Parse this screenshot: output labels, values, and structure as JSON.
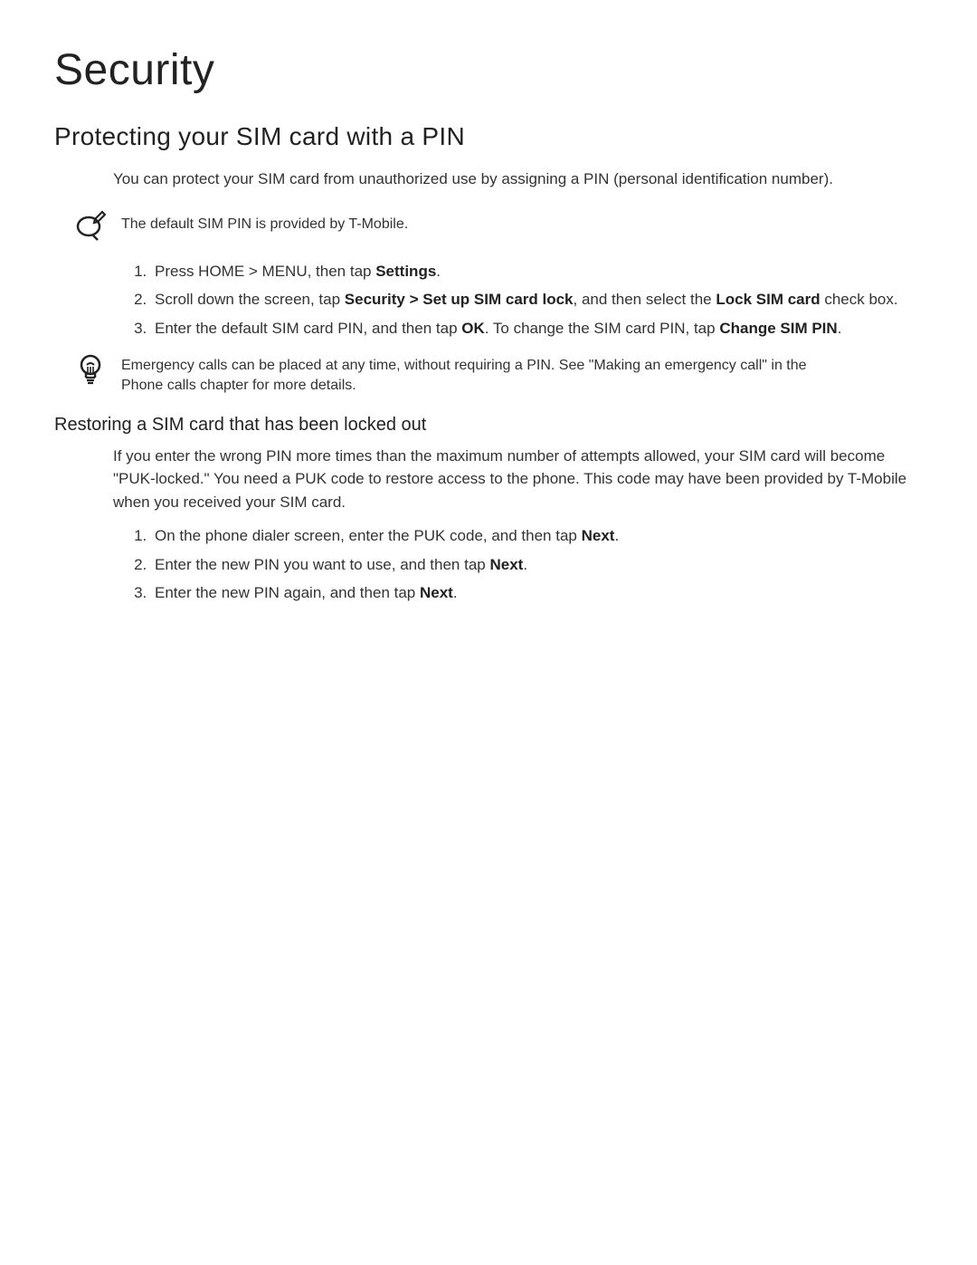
{
  "title": "Security",
  "section1": {
    "heading": "Protecting your SIM card with a PIN",
    "intro": "You can protect your SIM card from unauthorized use by assigning a PIN (personal identification number).",
    "note": "The default SIM PIN is provided by T-Mobile.",
    "steps": {
      "s1a": "Press HOME > MENU, then tap ",
      "s1b_bold": "Settings",
      "s1c": ".",
      "s2a": "Scroll down the screen, tap ",
      "s2b_bold": "Security > Set up SIM card lock",
      "s2c": ", and then select the ",
      "s2d_bold": "Lock SIM card",
      "s2e": " check box.",
      "s3a": "Enter the default SIM card PIN, and then tap ",
      "s3b_bold": "OK",
      "s3c": ". To change the SIM card PIN, tap ",
      "s3d_bold": "Change SIM PIN",
      "s3e": "."
    },
    "tip": "Emergency calls can be placed at any time, without requiring a PIN. See \"Making an emergency call\" in the Phone calls chapter for more details."
  },
  "section2": {
    "heading": "Restoring a SIM card that has been locked out",
    "intro": "If you enter the wrong PIN more times than the maximum number of attempts allowed, your SIM card will become \"PUK-locked.\" You need a PUK code to restore access to the phone. This code may have been provided by T-Mobile when you received your SIM card.",
    "steps": {
      "s1a": "On the phone dialer screen, enter the PUK code, and then tap ",
      "s1b_bold": "Next",
      "s1c": ".",
      "s2a": "Enter the new PIN you want to use, and then tap ",
      "s2b_bold": "Next",
      "s2c": ".",
      "s3a": "Enter the new PIN again, and then tap ",
      "s3b_bold": "Next",
      "s3c": "."
    }
  }
}
